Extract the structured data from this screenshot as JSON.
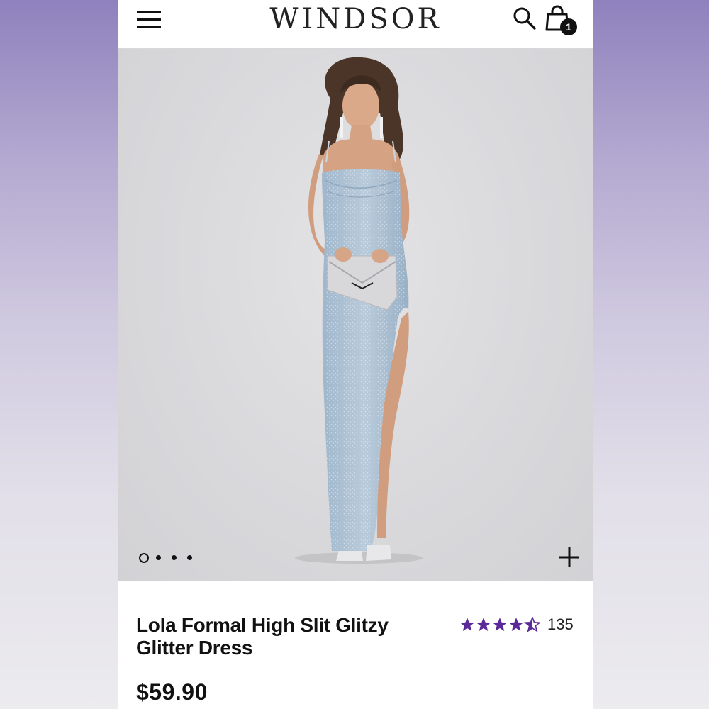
{
  "header": {
    "brand": "WINDSOR",
    "menu_icon": "hamburger-menu-icon",
    "search_icon": "search-icon",
    "bag_icon": "shopping-bag-icon",
    "bag_count": "1"
  },
  "gallery": {
    "image_count": 4,
    "active_index": 0,
    "zoom_icon": "plus-icon",
    "background_color": "#dcdcdf",
    "dress_color": "#a9bfd3"
  },
  "product": {
    "title": "Lola Formal High Slit Glitzy Glitter Dress",
    "rating": 4.5,
    "rating_max": 5,
    "review_count": "135",
    "price": "$59.90",
    "star_color": "#5b2a98"
  }
}
